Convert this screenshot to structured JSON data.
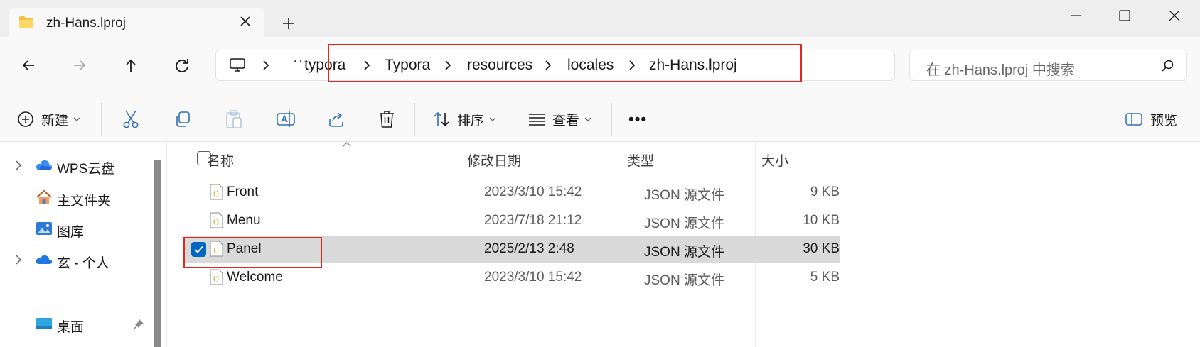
{
  "tab": {
    "title": "zh-Hans.lproj",
    "icon": "folder-icon"
  },
  "address": {
    "more": "···",
    "crumbs": [
      "typora",
      "Typora",
      "resources",
      "locales",
      "zh-Hans.lproj"
    ]
  },
  "search": {
    "placeholder": "在 zh-Hans.lproj 中搜索"
  },
  "commands": {
    "new_label": "新建",
    "sort_label": "排序",
    "view_label": "查看",
    "more_label": "•••",
    "preview_label": "预览"
  },
  "nav": {
    "items": [
      {
        "label": "WPS云盘",
        "icon": "cloud-icon"
      },
      {
        "label": "主文件夹",
        "icon": "home-icon"
      },
      {
        "label": "图库",
        "icon": "gallery-icon"
      },
      {
        "label": "玄 - 个人",
        "icon": "onedrive-icon"
      },
      {
        "label": "桌面",
        "icon": "desktop-icon"
      }
    ]
  },
  "columns": {
    "name": "名称",
    "date": "修改日期",
    "type": "类型",
    "size": "大小"
  },
  "files": [
    {
      "name": "Front",
      "date": "2023/3/10 15:42",
      "type": "JSON 源文件",
      "size": "9 KB",
      "selected": false
    },
    {
      "name": "Menu",
      "date": "2023/7/18 21:12",
      "type": "JSON 源文件",
      "size": "10 KB",
      "selected": false
    },
    {
      "name": "Panel",
      "date": "2025/2/13 2:48",
      "type": "JSON 源文件",
      "size": "30 KB",
      "selected": true
    },
    {
      "name": "Welcome",
      "date": "2023/3/10 15:42",
      "type": "JSON 源文件",
      "size": "5 KB",
      "selected": false
    }
  ],
  "colors": {
    "accent": "#0067c0",
    "highlight_box": "#e0281e",
    "selected_row": "#d9d9d9"
  }
}
